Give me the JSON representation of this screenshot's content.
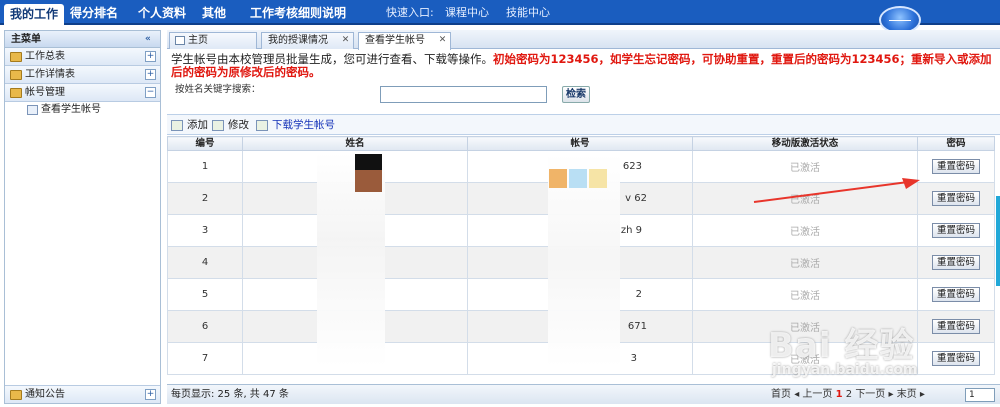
{
  "topnav": {
    "tabs": [
      "我的工作",
      "得分排名",
      "个人资料",
      "其他",
      "工作考核细则说明"
    ],
    "quick_label": "快速入口:",
    "quick_links": [
      "课程中心",
      "技能中心"
    ]
  },
  "sidebar": {
    "title": "主菜单",
    "groups": [
      "工作总表",
      "工作详情表",
      "帐号管理"
    ],
    "sub_item": "查看学生帐号",
    "bottom": "通知公告"
  },
  "page_tabs": [
    "主页",
    "我的授课情况",
    "查看学生帐号"
  ],
  "message": {
    "normal": "学生帐号由本校管理员批量生成，您可进行查看、下载等操作。",
    "red_line1": "初始密码为123456，如学生忘记密码，可协助重置，重置后的密码为123456；重新导入或添加",
    "red_line2": "后的密码为原修改后的密码。"
  },
  "search": {
    "label": "按姓名关键字搜索：",
    "button": "检索"
  },
  "toolbar": {
    "add": "添加",
    "edit": "修改",
    "download": "下载学生帐号"
  },
  "grid": {
    "columns": [
      "编号",
      "姓名",
      "帐号",
      "移动版激活状态",
      "密码"
    ],
    "rows": [
      {
        "no": "1",
        "name": "",
        "account": "623",
        "status": "已激活",
        "action": "重置密码"
      },
      {
        "no": "2",
        "name": "",
        "account": "v 62",
        "status": "已激活",
        "action": "重置密码"
      },
      {
        "no": "3",
        "name": "",
        "account": "zh 9",
        "status": "已激活",
        "action": "重置密码"
      },
      {
        "no": "4",
        "name": "",
        "account": "",
        "status": "已激活",
        "action": "重置密码"
      },
      {
        "no": "5",
        "name": "",
        "account": "2",
        "status": "已激活",
        "action": "重置密码"
      },
      {
        "no": "6",
        "name": "",
        "account": "671",
        "status": "已激活",
        "action": "重置密码"
      },
      {
        "no": "7",
        "name": "",
        "account": "3",
        "status": "已激活",
        "action": "重置密码"
      }
    ]
  },
  "pager": {
    "info": "每页显示: 25 条, 共 47 条",
    "first": "首页",
    "prev": "上一页",
    "page1": "1",
    "page2": "2",
    "next": "下一页",
    "last": "末页",
    "page_input": "1"
  },
  "watermark": {
    "big": "Bai 经验",
    "small": "jingyan.baidu.com"
  },
  "colors": {
    "nav_blue": "#1a5dbf",
    "red_text": "#e0170f",
    "arrow": "#e8352b"
  }
}
